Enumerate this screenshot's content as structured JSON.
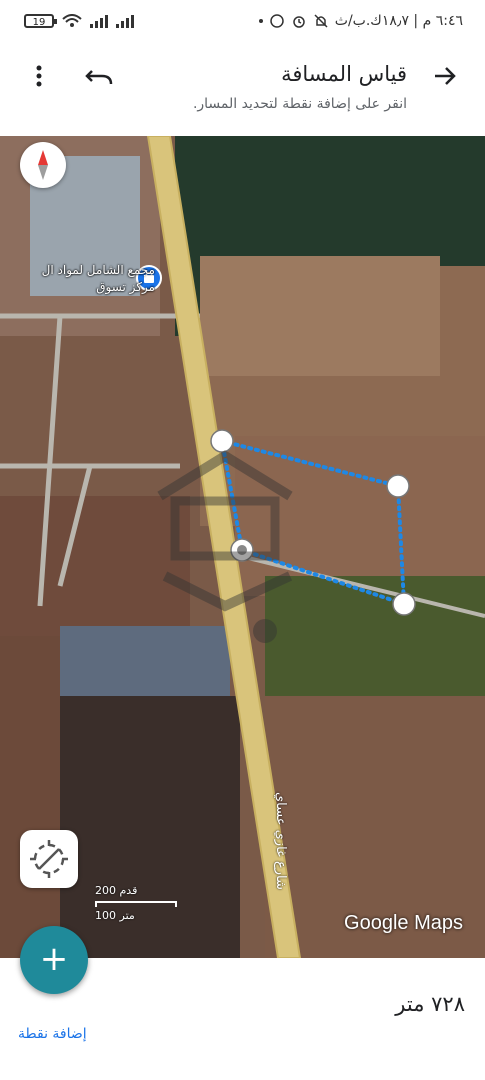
{
  "status_bar": {
    "battery": "19",
    "time_info": "٦:٤٦ م | ١٨٫٧ك.ب/ث"
  },
  "header": {
    "title": "قياس المسافة",
    "subtitle": "انقر على إضافة نقطة لتحديد المسار."
  },
  "map": {
    "place_name_line1": "مجمع الشامل لمواد ال",
    "place_name_line2": "مركز تسوق",
    "street_name": "شارع غازي عساي",
    "scale_imperial": "200 قدم",
    "scale_metric": "100 متر",
    "attribution": "Google Maps",
    "route_color": "#1e88e5"
  },
  "bottom": {
    "distance": "٧٢٨ متر",
    "add_point": "إضافة نقطة"
  },
  "icons": {
    "back": "arrow-right-icon",
    "undo": "undo-icon",
    "more": "more-vert-icon",
    "compass": "compass-icon",
    "locate": "location-disabled-icon",
    "add": "plus-icon"
  }
}
